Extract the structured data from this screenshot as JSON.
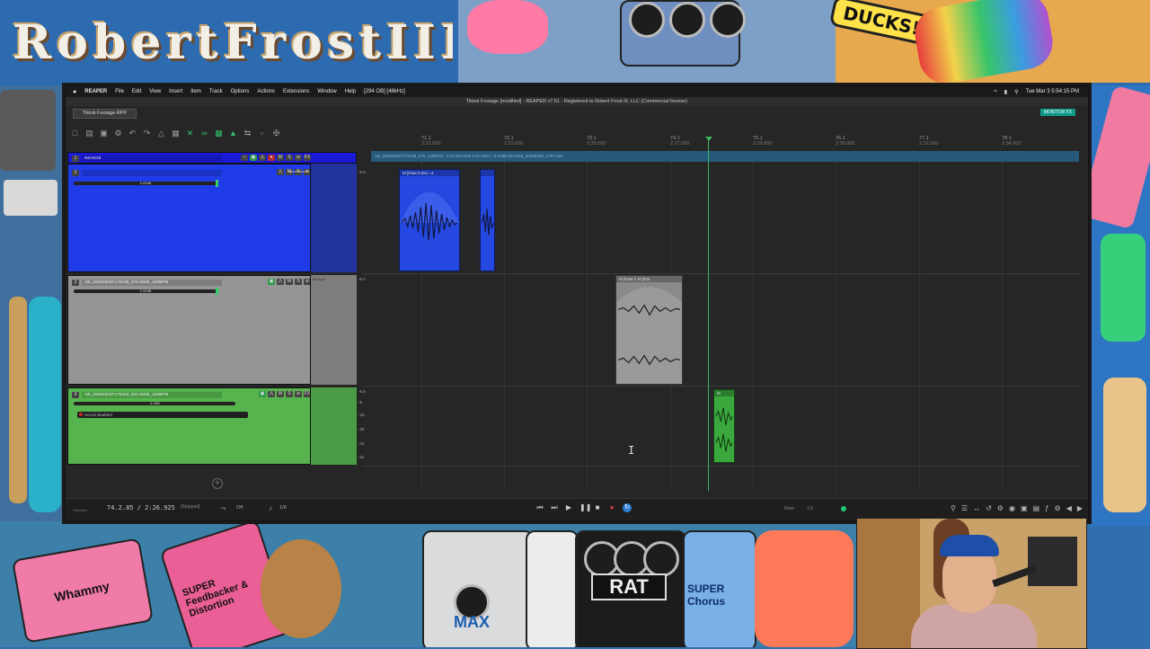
{
  "overlay": {
    "logo_text": "RobertFrostIII",
    "sticker_ducks": "DUCKS!",
    "pedal_rat": "RAT",
    "pedal_chorus": "SUPER Chorus",
    "pedal_feedbacker": "SUPER Feedbacker & Distortion",
    "pedal_max": "MAX",
    "pedal_whammy": "Whammy"
  },
  "menubar": {
    "apple": "",
    "app": "REAPER",
    "items": [
      "File",
      "Edit",
      "View",
      "Insert",
      "Item",
      "Track",
      "Options",
      "Actions",
      "Extensions",
      "Window",
      "Help"
    ],
    "sample_rate": "[294 OB] [48kHz]",
    "clock": "Tue Mar 3  5:54:15 PM"
  },
  "window": {
    "title": "Tiktok Footage [modified] - REAPER v7.61 - Registered to Robert Frost III, LLC (Commercial license)",
    "project_tab": "Tiktok Footage.RPP",
    "monitor_fx": "MONITOR FX"
  },
  "ruler": {
    "marks": [
      {
        "bar": "71.1",
        "time": "2:21.000"
      },
      {
        "bar": "72.1",
        "time": "2:23.000"
      },
      {
        "bar": "73.1",
        "time": "2:25.000"
      },
      {
        "bar": "74.1",
        "time": "2:27.000"
      },
      {
        "bar": "75.1",
        "time": "2:29.000"
      },
      {
        "bar": "76.1",
        "time": "2:30.000"
      },
      {
        "bar": "77.1",
        "time": "2:32.000"
      },
      {
        "bar": "78.1",
        "time": "2:34.000"
      }
    ]
  },
  "tracks": [
    {
      "number": "1",
      "name": "NKH418",
      "color": "#1a1ad6",
      "volume": "",
      "route": "",
      "children": [
        {
          "number": "2",
          "name": "",
          "volume": "0.00dB",
          "route": "SpectRender",
          "color": "#1a46e6"
        }
      ]
    },
    {
      "number": "3",
      "name": "AB_20260303T175135_075-0600_120BPM",
      "volume": "0.00dB",
      "route": "MPagur",
      "color": "#9a9a9a"
    },
    {
      "number": "4",
      "name": "AB_20260303T175340_822-0600_120BPM",
      "volume": "-4.9dB",
      "route": "",
      "color": "#56b34e",
      "record_label": "record disabled"
    }
  ],
  "folder_bar_text": "AB_20260303T175135_075_120BPM  -  0:13  NKH418  1757.wav   |   -5.10dB  NKH418_20260303_1757.wav",
  "items": [
    {
      "label": "M [Rate:0.661 +4",
      "track": 0
    },
    {
      "label": "",
      "track": 0
    },
    {
      "label": "M [Rate:1    M [Rat",
      "track": 1
    },
    {
      "label": "M",
      "track": 2
    }
  ],
  "db_scale": [
    "-6.9",
    "-6.4",
    "-6.5",
    "-6",
    "-18",
    "-30",
    "-42",
    "-54"
  ],
  "transport": {
    "time": "74.2.85 / 2:26.925",
    "status": "[Stopped]",
    "selection": "Selection",
    "snap": "Off",
    "grid": "1/8",
    "rate_label": "Rate:",
    "rate_value": "1.0"
  },
  "colors": {
    "accent_blue": "#2d7fd6",
    "record_red": "#e23b3b",
    "play_cursor": "#3cb55a",
    "monitor_fx": "#0e9a8a"
  }
}
